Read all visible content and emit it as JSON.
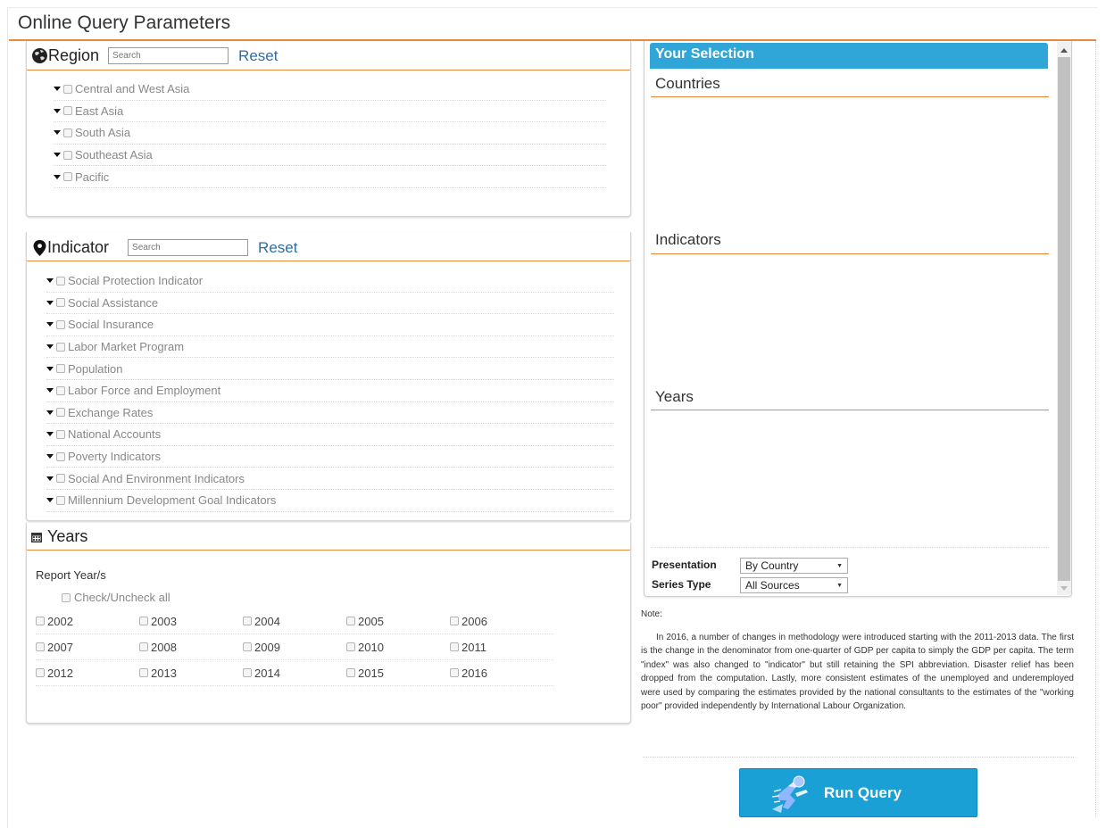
{
  "page": {
    "title": "Online Query Parameters"
  },
  "region": {
    "title": "Region",
    "search_placeholder": "Search",
    "reset_label": "Reset",
    "items": [
      "Central and West Asia",
      "East Asia",
      "South Asia",
      "Southeast Asia",
      "Pacific"
    ]
  },
  "indicator": {
    "title": "Indicator",
    "search_placeholder": "Search",
    "reset_label": "Reset",
    "items": [
      "Social Protection Indicator",
      "Social Assistance",
      "Social Insurance",
      "Labor Market Program",
      "Population",
      "Labor Force and Employment",
      "Exchange Rates",
      "National Accounts",
      "Poverty Indicators",
      "Social And Environment Indicators",
      "Millennium Development Goal Indicators"
    ]
  },
  "years": {
    "title": "Years",
    "report_label": "Report Year/s",
    "check_all_label": "Check/Uncheck all",
    "rows": [
      [
        "2002",
        "2003",
        "2004",
        "2005",
        "2006"
      ],
      [
        "2007",
        "2008",
        "2009",
        "2010",
        "2011"
      ],
      [
        "2012",
        "2013",
        "2014",
        "2015",
        "2016"
      ]
    ]
  },
  "selection": {
    "header": "Your Selection",
    "countries_label": "Countries",
    "indicators_label": "Indicators",
    "years_label": "Years",
    "presentation_label": "Presentation",
    "presentation_value": "By Country",
    "series_type_label": "Series Type",
    "series_type_value": "All Sources"
  },
  "note": {
    "label": "Note:",
    "text": "In 2016, a number of changes in methodology were introduced starting with the 2011-2013 data. The first is the change in the denominator from one-quarter of GDP per capita to simply the GDP per capita. The term \"index\" was also changed to \"indicator\" but still retaining the SPI abbreviation. Disaster relief has been dropped from the computation. Lastly, more consistent estimates of the unemployed and underemployed were used by comparing the estimates provided by the national consultants to the estimates of the \"working poor\" provided independently by International Labour Organization."
  },
  "run_button": {
    "label": "Run Query"
  },
  "colors": {
    "accent_rule": "#e58c3f",
    "header_blue": "#2fa6d7",
    "link_blue": "#2e6da4",
    "button_blue": "#1aa0d4"
  }
}
